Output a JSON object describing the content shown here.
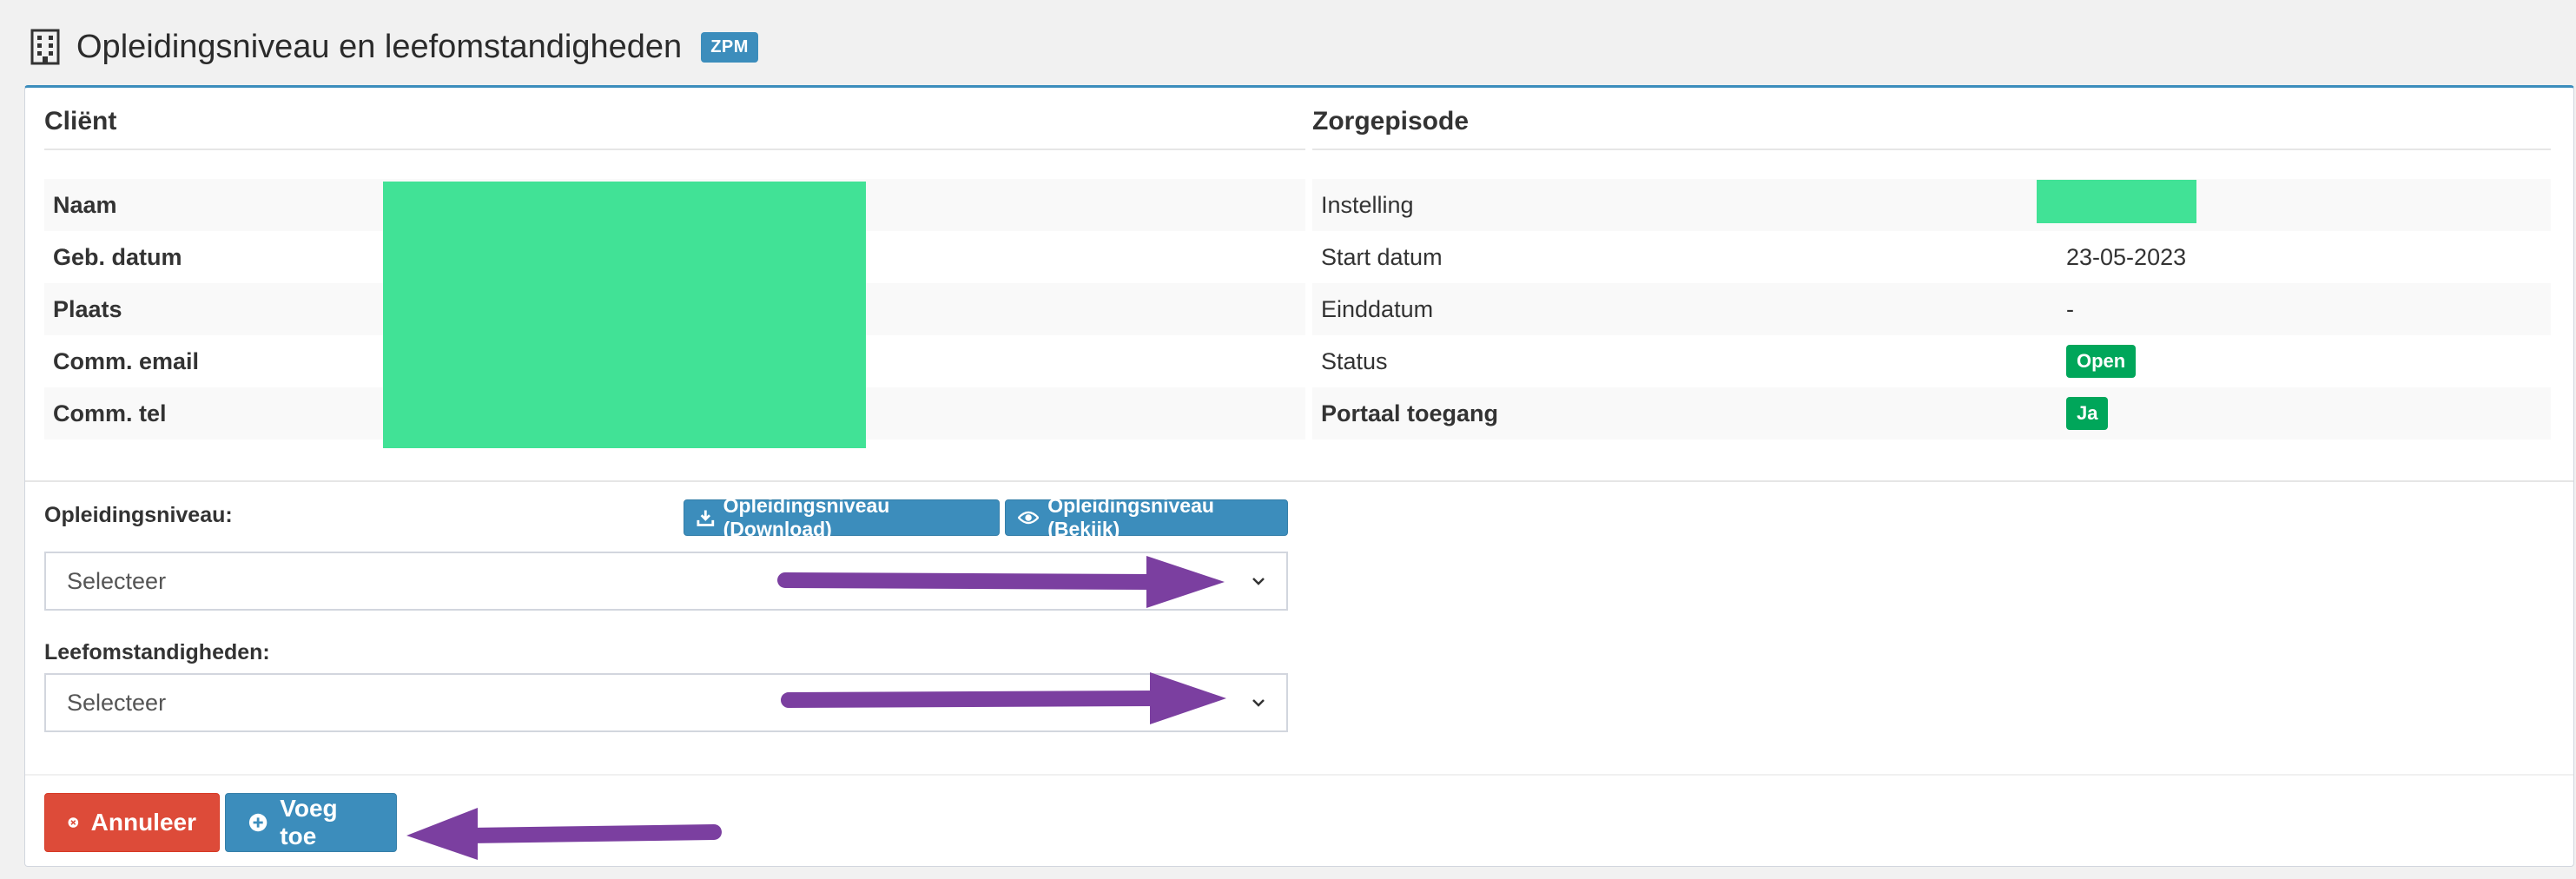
{
  "header": {
    "title": "Opleidingsniveau en leefomstandigheden",
    "badge": "ZPM",
    "icon": "building-icon"
  },
  "client": {
    "heading": "Cliënt",
    "rows": [
      {
        "label": "Naam"
      },
      {
        "label": "Geb. datum"
      },
      {
        "label": "Plaats"
      },
      {
        "label": "Comm. email"
      },
      {
        "label": "Comm. tel"
      }
    ]
  },
  "episode": {
    "heading": "Zorgepisode",
    "rows": [
      {
        "label": "Instelling",
        "value": ""
      },
      {
        "label": "Start datum",
        "value": "23-05-2023"
      },
      {
        "label": "Einddatum",
        "value": "-"
      },
      {
        "label": "Status",
        "value": "Open"
      },
      {
        "label": "Portaal toegang",
        "value": "Ja"
      }
    ]
  },
  "form": {
    "education_label": "Opleidingsniveau:",
    "download_button": "Opleidingsniveau (Download)",
    "view_button": "Opleidingsniveau (Bekijk)",
    "education_select": "Selecteer",
    "living_label": "Leefomstandigheden:",
    "living_select": "Selecteer"
  },
  "actions": {
    "cancel": "Annuleer",
    "add": "Voeg toe"
  },
  "colors": {
    "primary": "#3c8dbc",
    "danger": "#dd4b39",
    "success": "#00a65a",
    "redaction": "#41e296",
    "annotation_arrow": "#7b3fa0"
  }
}
